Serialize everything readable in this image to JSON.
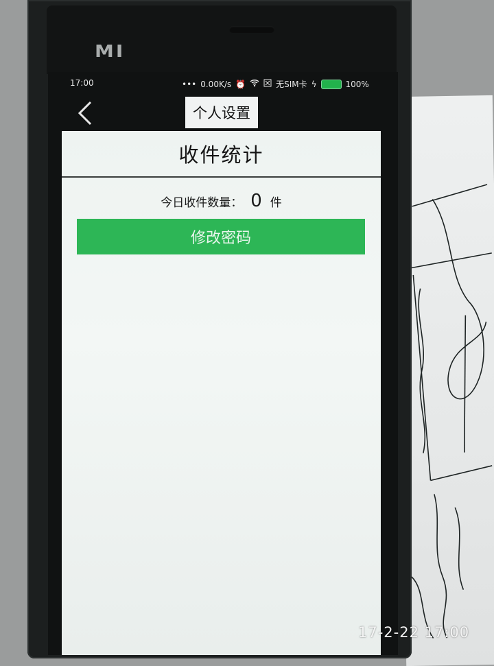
{
  "phone": {
    "brand": "MI"
  },
  "status_bar": {
    "time": "17:00",
    "network_speed": "0.00K/s",
    "sim_text": "无SIM卡",
    "battery_percent": "100%",
    "battery_color": "#22b24c"
  },
  "nav": {
    "back_icon": "chevron-left-icon",
    "title": "个人设置"
  },
  "main": {
    "section_title": "收件统计",
    "today_count": {
      "label": "今日收件数量：",
      "value": "0",
      "unit": "件"
    },
    "change_password_label": "修改密码",
    "accent_color": "#2db656"
  },
  "photo": {
    "timestamp": "17-2-22 17:00"
  }
}
